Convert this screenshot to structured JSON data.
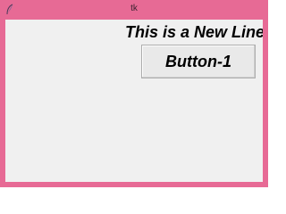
{
  "window": {
    "title": "tk",
    "app_icon": "feather-icon",
    "frame_color": "#e76a95",
    "client_color": "#f0f0f0"
  },
  "content": {
    "heading": "This is a New Line Text",
    "button_1_label": "Button-1"
  }
}
